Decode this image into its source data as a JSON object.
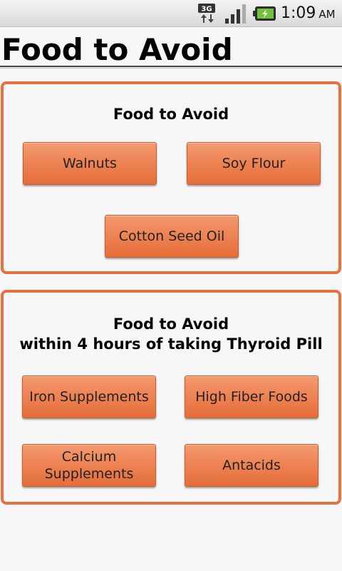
{
  "status_bar": {
    "network_label": "3G",
    "network_icon": "network-3g-icon",
    "signal_icon": "signal-strength-icon",
    "battery_icon": "battery-charging-icon",
    "time": "1:09",
    "ampm": "AM"
  },
  "app": {
    "title": "Food to Avoid"
  },
  "section_general": {
    "heading": "Food to Avoid",
    "items": [
      "Walnuts",
      "Soy Flour",
      "Cotton Seed Oil"
    ]
  },
  "section_thyroid": {
    "heading_line1": "Food to Avoid",
    "heading_line2": "within 4 hours of taking Thyroid Pill",
    "items": [
      "Iron Supplements",
      "High Fiber Foods",
      "Calcium Supplements",
      "Antacids"
    ]
  },
  "colors": {
    "accent": "#e8703e",
    "button_top": "#f39a70",
    "button_bottom": "#e56e3b",
    "background": "#f7f7f7"
  }
}
